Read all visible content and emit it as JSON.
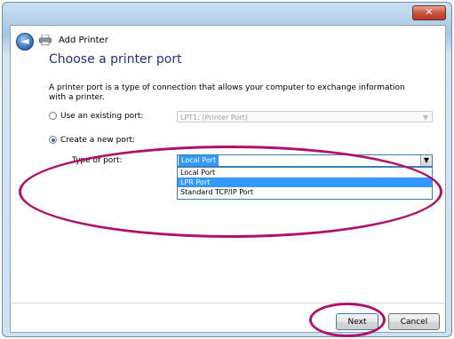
{
  "window": {
    "title": "Add Printer"
  },
  "icons": {
    "back": "back-arrow-icon",
    "printer": "printer-icon",
    "close": "close-icon"
  },
  "close_glyph": "✕",
  "page": {
    "heading": "Choose a printer port",
    "description": "A printer port is a type of connection that allows your computer to exchange information with a printer."
  },
  "existing_port": {
    "label": "Use an existing port:",
    "selected": "LPT1: (Printer Port)",
    "checked": false
  },
  "new_port": {
    "label": "Create a new port:",
    "checked": true,
    "type_label": "Type of port:",
    "selected": "Local Port",
    "options": [
      "Local Port",
      "LPR Port",
      "Standard TCP/IP Port"
    ],
    "highlighted_option": "LPR Port"
  },
  "buttons": {
    "next": "Next",
    "cancel": "Cancel"
  },
  "colors": {
    "heading": "#1e3287",
    "highlight": "#3399ff",
    "annotation": "#b0126b"
  }
}
